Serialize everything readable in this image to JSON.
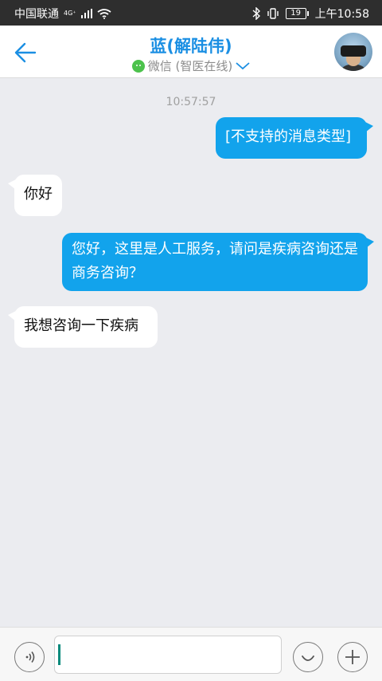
{
  "status_bar": {
    "carrier": "中国联通",
    "network": "4G⁺",
    "battery": "19",
    "time": "上午10:58"
  },
  "header": {
    "title": "蓝(解陆伟)",
    "subtitle": "微信 (智医在线)"
  },
  "chat": {
    "timestamp": "10:57:57",
    "messages": [
      {
        "side": "right",
        "text": "[不支持的消息类型]"
      },
      {
        "side": "left",
        "text": "你好"
      },
      {
        "side": "right",
        "text": "您好，这里是人工服务，请问是疾病咨询还是商务咨询？"
      },
      {
        "side": "left",
        "text": "我想咨询一下疾病"
      }
    ]
  },
  "input": {
    "value": "",
    "placeholder": ""
  },
  "colors": {
    "accent": "#1b8fe3",
    "bubble_me": "#12a3ec",
    "background": "#ebecf0",
    "wechat_green": "#4cc24c"
  }
}
